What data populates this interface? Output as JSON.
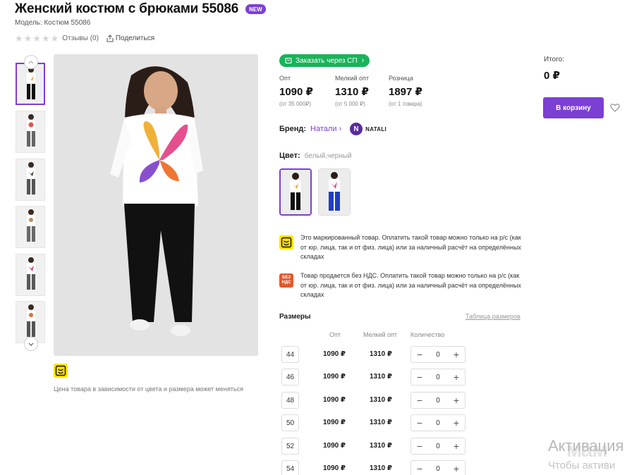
{
  "product": {
    "title": "Женский костюм с брюками 55086",
    "badge": "NEW",
    "model": "Модель: Костюм 55086",
    "reviews": "Отзывы (0)",
    "share": "Поделиться",
    "price_note": "Цена товара в зависимости от цвета и размера может меняться"
  },
  "order": {
    "sp_button": "Заказать через СП"
  },
  "prices": [
    {
      "label": "Опт",
      "value": "1090 ₽",
      "note": "(от 35 000₽)"
    },
    {
      "label": "Мелкий опт",
      "value": "1310 ₽",
      "note": "(от 5 000 ₽)"
    },
    {
      "label": "Розница",
      "value": "1897 ₽",
      "note": "(от 1 товара)"
    }
  ],
  "brand": {
    "label": "Бренд:",
    "name": "Натали",
    "logo_text": "NATALI",
    "logo_letter": "N"
  },
  "color": {
    "label": "Цвет:",
    "value": "белый,черный"
  },
  "notices": [
    {
      "icon": "marking-icon",
      "text": "Это маркированный товар. Оплатить такой товар можно только на р/с (как от юр. лица, так и от физ. лица) или за наличный расчёт на определённых складах"
    },
    {
      "icon": "no-vat-icon",
      "icon_text": "БЕЗ НДС",
      "text": "Товар продается без НДС. Оплатить такой товар можно только на р/с (как от юр. лица, так и от физ. лица) или за наличный расчёт на определённых складах"
    }
  ],
  "sizes": {
    "title": "Размеры",
    "table_link": "Таблица размеров",
    "headers": {
      "opt": "Опт",
      "small_opt": "Мелкий опт",
      "qty": "Количество"
    },
    "rows": [
      {
        "size": "44",
        "opt": "1090 ₽",
        "small": "1310 ₽",
        "qty": "0"
      },
      {
        "size": "46",
        "opt": "1090 ₽",
        "small": "1310 ₽",
        "qty": "0"
      },
      {
        "size": "48",
        "opt": "1090 ₽",
        "small": "1310 ₽",
        "qty": "0"
      },
      {
        "size": "50",
        "opt": "1090 ₽",
        "small": "1310 ₽",
        "qty": "0"
      },
      {
        "size": "52",
        "opt": "1090 ₽",
        "small": "1310 ₽",
        "qty": "0"
      },
      {
        "size": "54",
        "opt": "1090 ₽",
        "small": "1310 ₽",
        "qty": "0"
      }
    ]
  },
  "cart": {
    "total_label": "Итого:",
    "total_value": "0 ₽",
    "button": "В корзину"
  },
  "overlay": {
    "activation_title": "Активация",
    "activation_sub": "Чтобы активи",
    "logo": "мам"
  },
  "colors": {
    "accent": "#7b3fd4",
    "green": "#18b35a",
    "marking_yellow": "#ffe100",
    "no_vat_orange": "#e2572b"
  }
}
